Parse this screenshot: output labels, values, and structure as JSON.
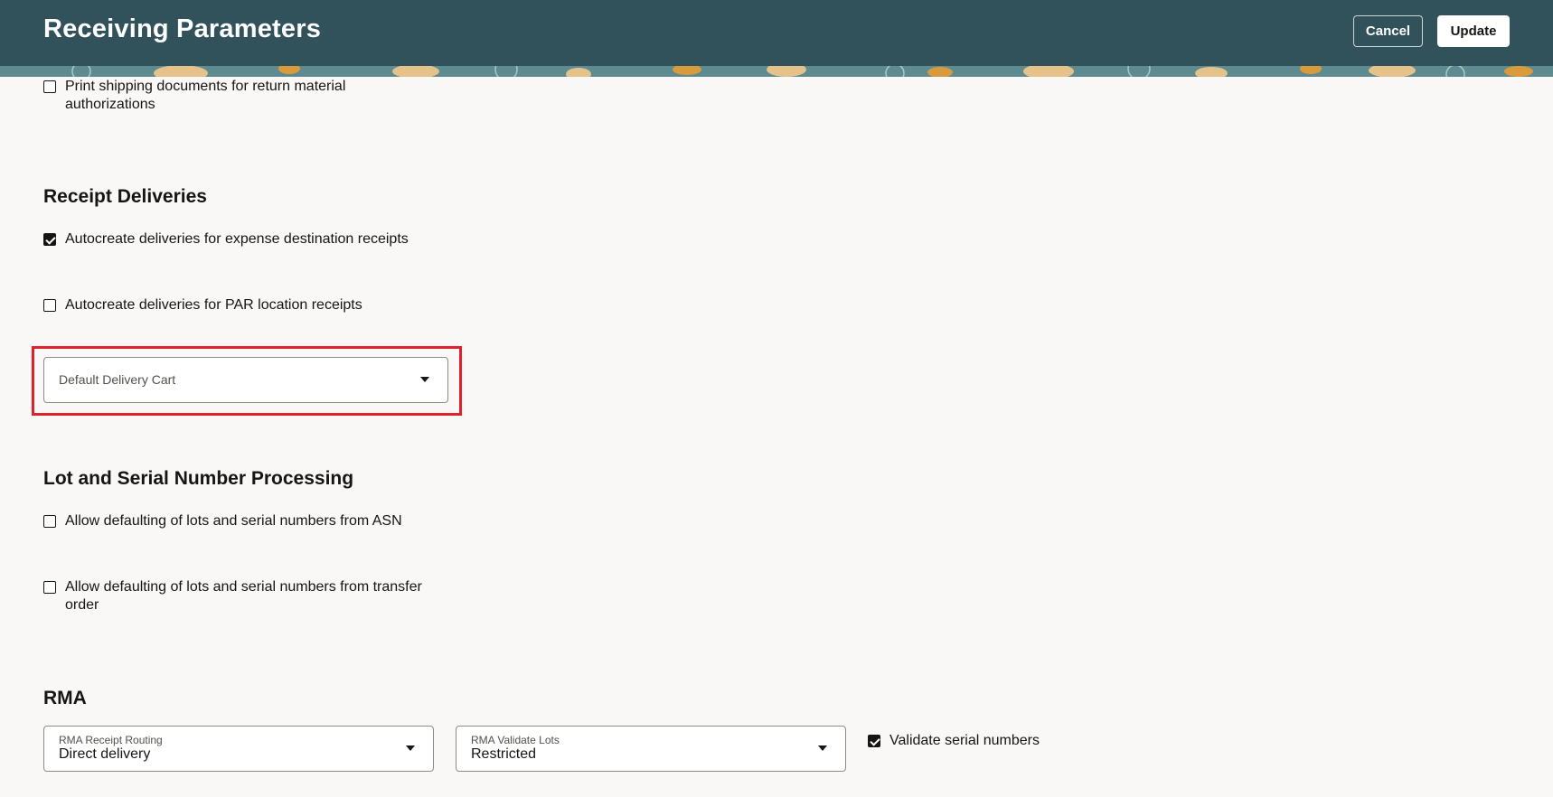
{
  "header": {
    "title": "Receiving Parameters",
    "cancel_label": "Cancel",
    "update_label": "Update"
  },
  "print_shipping": {
    "label": "Print shipping documents for return material authorizations",
    "checked": false
  },
  "receipt_deliveries": {
    "title": "Receipt Deliveries",
    "autocreate_expense": {
      "label": "Autocreate deliveries for expense destination receipts",
      "checked": true
    },
    "autocreate_par": {
      "label": "Autocreate deliveries for PAR location receipts",
      "checked": false
    },
    "default_delivery_cart": {
      "placeholder": "Default Delivery Cart",
      "value": ""
    }
  },
  "lot_serial": {
    "title": "Lot and Serial Number Processing",
    "asn": {
      "label": "Allow defaulting of lots and serial numbers from ASN",
      "checked": false
    },
    "transfer_order": {
      "label": "Allow defaulting of lots and serial numbers from transfer order",
      "checked": false
    }
  },
  "rma": {
    "title": "RMA",
    "receipt_routing": {
      "label": "RMA Receipt Routing",
      "value": "Direct delivery"
    },
    "validate_lots": {
      "label": "RMA Validate Lots",
      "value": "Restricted"
    },
    "validate_serial": {
      "label": "Validate serial numbers",
      "checked": true
    }
  },
  "colors": {
    "header_bg": "#31525b",
    "page_bg": "#f9f8f6",
    "highlight": "#e0202b"
  },
  "icons": {
    "dropdown": "chevron-down-icon",
    "check": "check-icon"
  }
}
